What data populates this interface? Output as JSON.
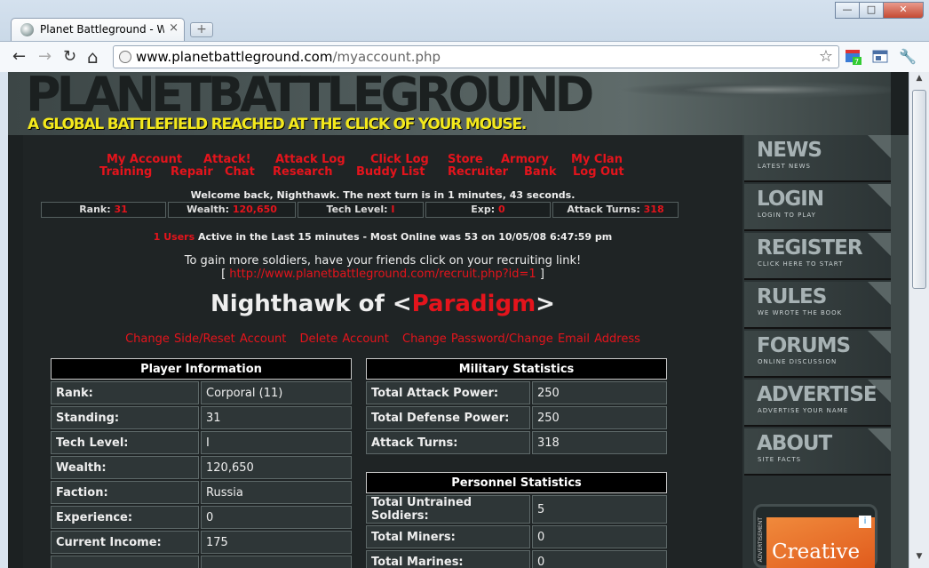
{
  "browser": {
    "tab_title": "Planet Battleground - Worl",
    "tab_close": "×",
    "new_tab": "+",
    "url_host": "www.planetbattleground.com",
    "url_path": "/myaccount.php",
    "back": "←",
    "forward": "→",
    "reload": "↻",
    "home": "⌂",
    "star": "☆",
    "wrench": "🔧",
    "min": "—",
    "max": "□",
    "close": "✕"
  },
  "banner": {
    "logo": "PLANETBATTLEGROUND",
    "tagline": "A GLOBAL BATTLEFIELD REACHED AT THE CLICK OF YOUR MOUSE."
  },
  "topnav": {
    "row1": [
      "My Account",
      "Attack!",
      "Attack Log",
      "Click Log",
      "Store",
      "Armory",
      "My Clan"
    ],
    "row2": [
      "Training",
      "Repair",
      "Chat",
      "Research",
      "Buddy List",
      "Recruiter",
      "Bank",
      "Log Out"
    ]
  },
  "welcome": "Welcome back, Nighthawk. The next turn is in 1 minutes, 43 seconds.",
  "statbar": {
    "rank_label": "Rank:",
    "rank": "31",
    "wealth_label": "Wealth:",
    "wealth": "120,650",
    "tech_label": "Tech Level:",
    "tech": "I",
    "exp_label": "Exp:",
    "exp": "0",
    "turns_label": "Attack Turns:",
    "turns": "318"
  },
  "online": {
    "users": "1 Users",
    "text": " Active in the Last 15 minutes - Most Online was 53 on 10/05/08 6:47:59 pm"
  },
  "recruit": {
    "text": "To gain more soldiers, have your friends click on your recruiting link!",
    "open": "[ ",
    "link": "http://www.planetbattleground.com/recruit.php?id=1",
    "close": " ]"
  },
  "player": {
    "name": "Nighthawk of <",
    "clan": "Paradigm",
    "end": ">"
  },
  "account_links": [
    "Change Side/Reset Account",
    "Delete Account",
    "Change Password/Change Email Address"
  ],
  "player_info": {
    "title": "Player Information",
    "rows": [
      {
        "k": "Rank:",
        "v": "Corporal (11)"
      },
      {
        "k": "Standing:",
        "v": "31"
      },
      {
        "k": "Tech Level:",
        "v": "I"
      },
      {
        "k": "Wealth:",
        "v": "120,650"
      },
      {
        "k": "Faction:",
        "v": "Russia"
      },
      {
        "k": "Experience:",
        "v": "0"
      },
      {
        "k": "Current Income:",
        "v": "175"
      },
      {
        "k": "",
        "v": ""
      }
    ]
  },
  "military": {
    "title": "Military Statistics",
    "rows": [
      {
        "k": "Total Attack Power:",
        "v": "250"
      },
      {
        "k": "Total Defense Power:",
        "v": "250"
      },
      {
        "k": "Attack Turns:",
        "v": "318"
      }
    ]
  },
  "personnel": {
    "title": "Personnel Statistics",
    "rows": [
      {
        "k": "Total Untrained Soldiers:",
        "v": "5"
      },
      {
        "k": "Total Miners:",
        "v": "0"
      },
      {
        "k": "Total Marines:",
        "v": "0"
      }
    ]
  },
  "rightnav": [
    {
      "big": "NEWS",
      "small": "Latest News"
    },
    {
      "big": "LOGIN",
      "small": "Login to Play"
    },
    {
      "big": "REGISTER",
      "small": "Click Here to Start"
    },
    {
      "big": "RULES",
      "small": "We Wrote the Book"
    },
    {
      "big": "FORUMS",
      "small": "Online Discussion"
    },
    {
      "big": "ADVERTISE",
      "small": "Advertise Your Name"
    },
    {
      "big": "ABOUT",
      "small": "Site Facts"
    }
  ],
  "ad": {
    "text": "Creative",
    "side": "ADVERTISEMENT",
    "badge": "i"
  }
}
